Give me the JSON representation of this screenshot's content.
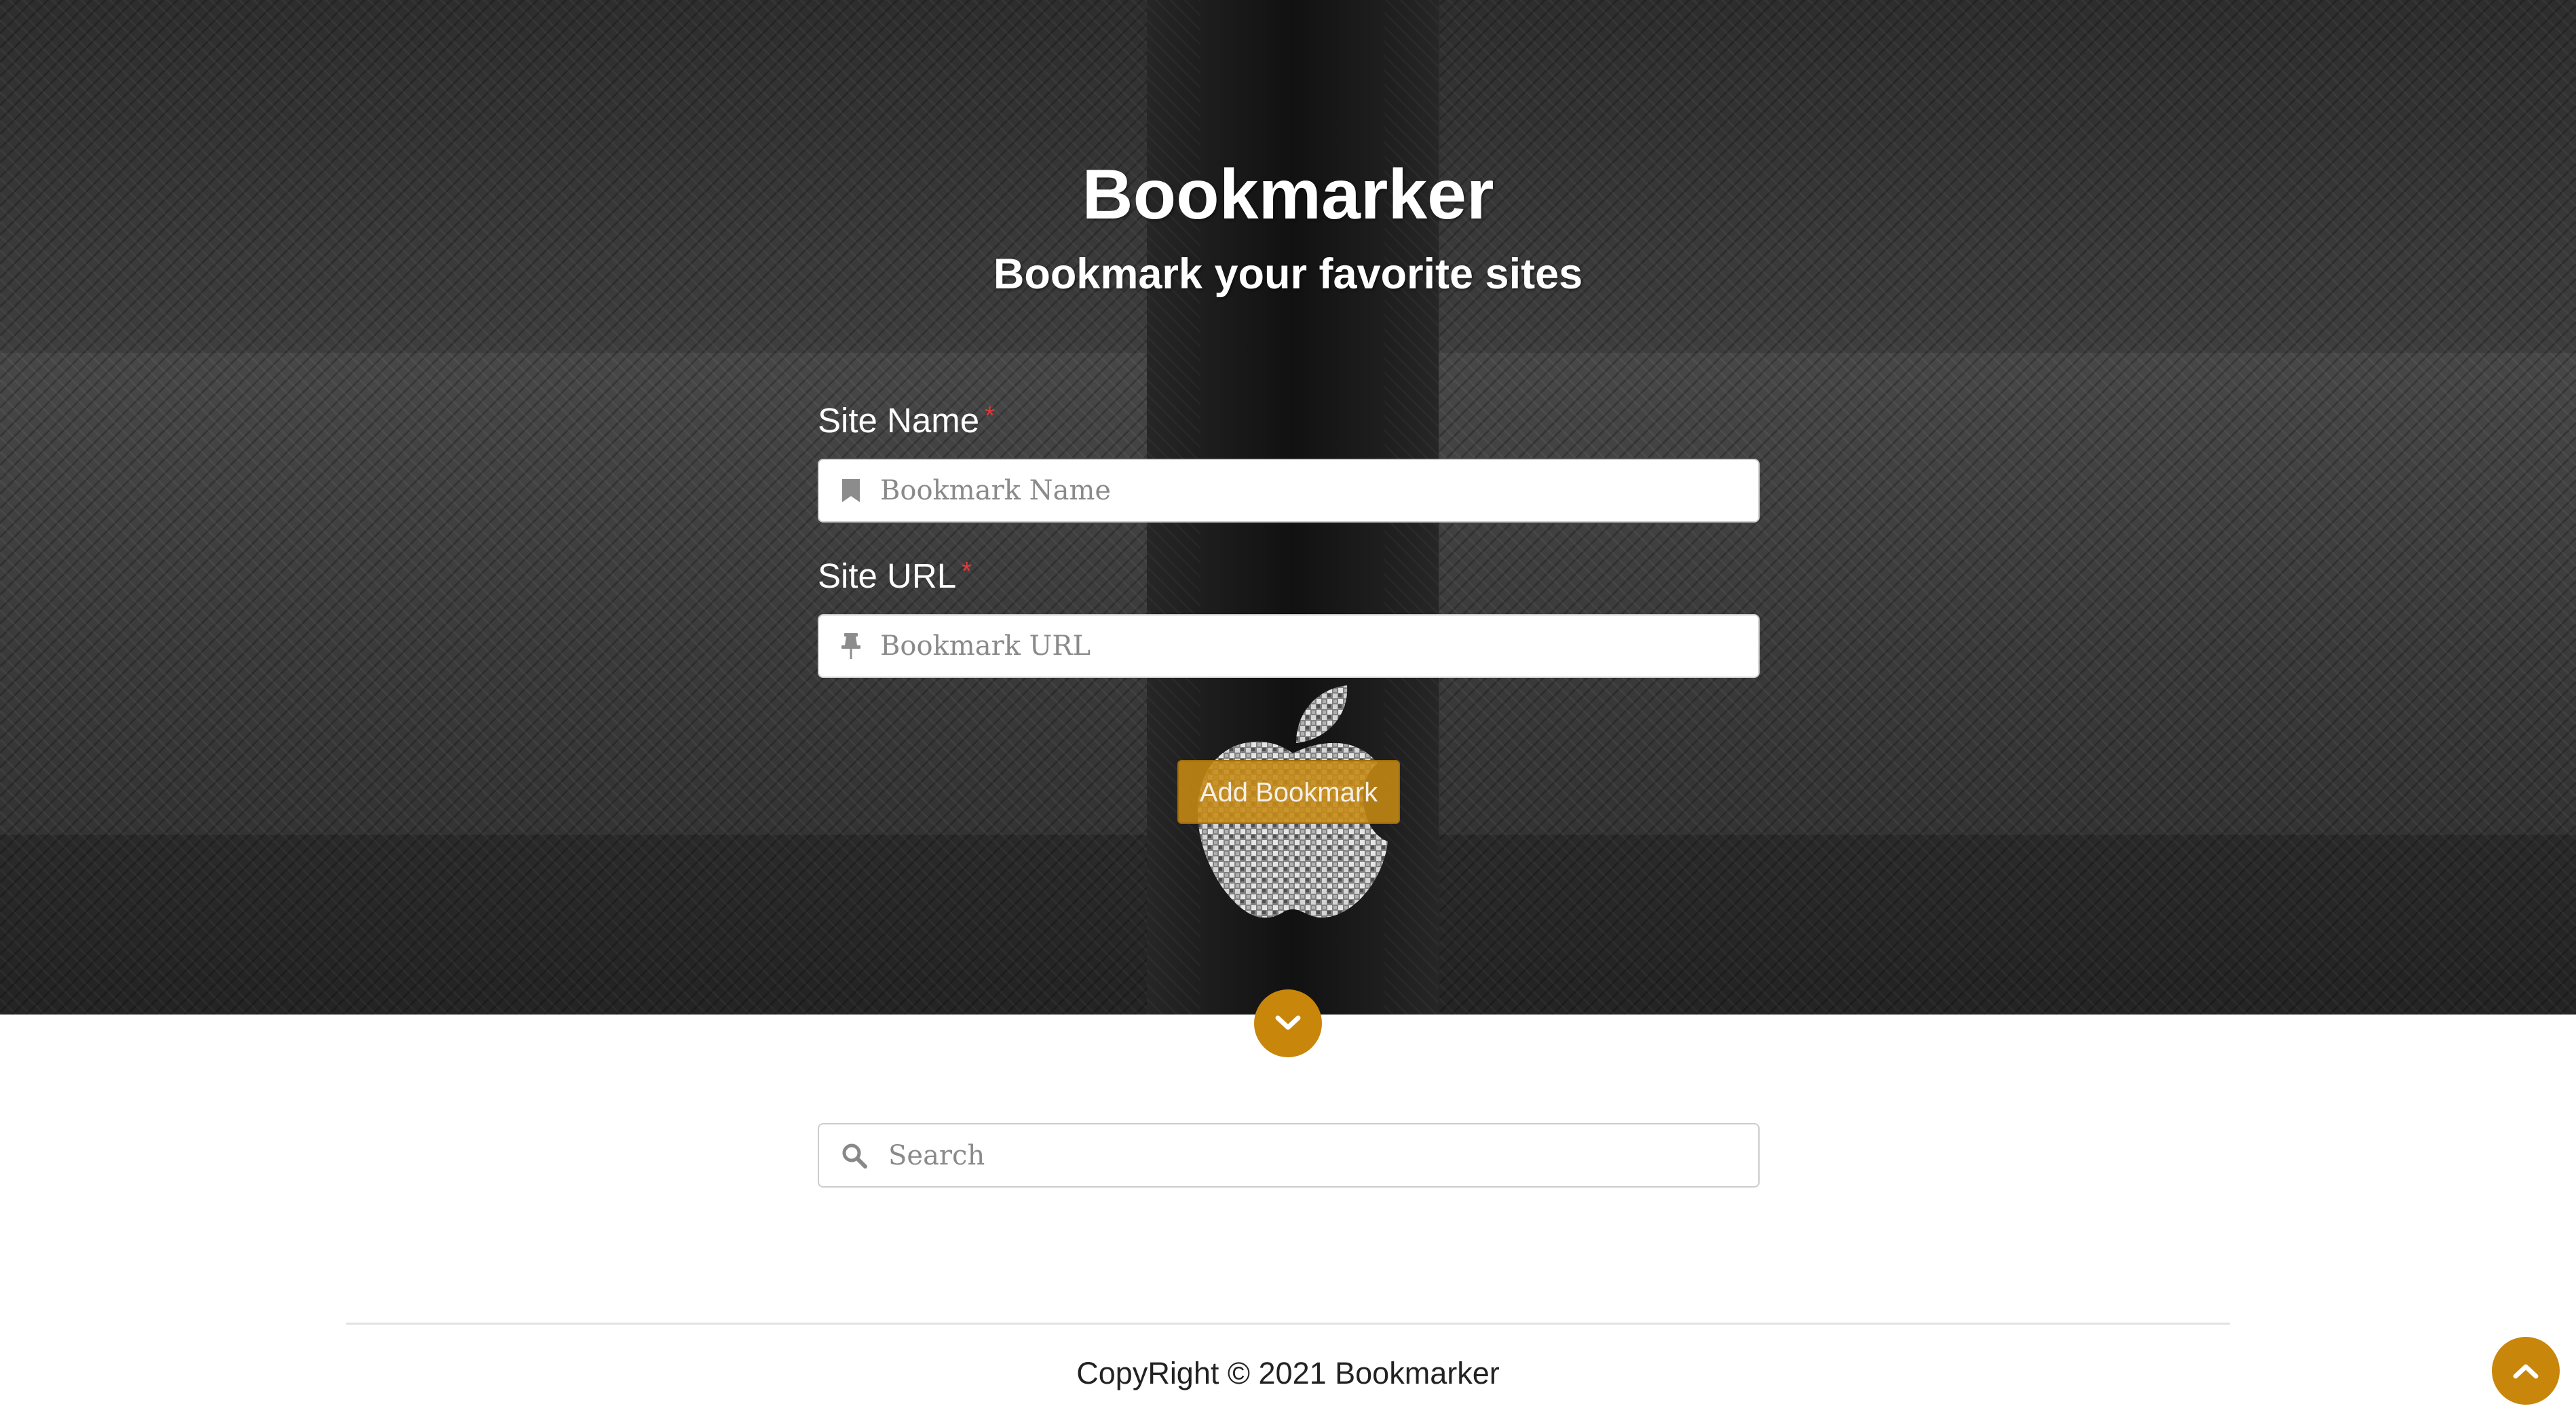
{
  "header": {
    "title": "Bookmarker",
    "subtitle": "Bookmark your favorite sites"
  },
  "form": {
    "site_name": {
      "label": "Site Name",
      "required_mark": "*",
      "placeholder": "Bookmark Name",
      "value": "",
      "icon": "bookmark-icon"
    },
    "site_url": {
      "label": "Site URL",
      "required_mark": "*",
      "placeholder": "Bookmark URL",
      "value": "",
      "icon": "thumbtack-icon"
    },
    "submit_label": "Add Bookmark"
  },
  "search": {
    "placeholder": "Search",
    "value": "",
    "icon": "search-icon"
  },
  "footer": {
    "copyright": "CopyRight © 2021 Bookmarker"
  },
  "controls": {
    "scroll_down_icon": "chevron-down-icon",
    "back_to_top_icon": "chevron-up-icon"
  },
  "colors": {
    "accent": "#c8860b",
    "required": "#e03a3a",
    "hero_text": "#ffffff",
    "footer_text": "#222222"
  }
}
